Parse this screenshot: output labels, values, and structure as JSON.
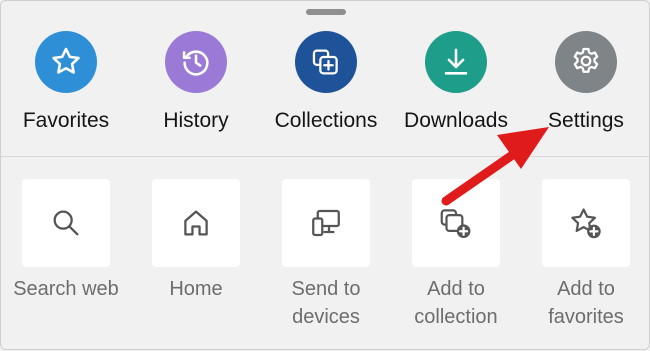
{
  "quick_actions": [
    {
      "label": "Favorites",
      "icon": "star-icon",
      "color": "#2f8fd6"
    },
    {
      "label": "History",
      "icon": "history-clock-icon",
      "color": "#9a7ad6"
    },
    {
      "label": "Collections",
      "icon": "collections-icon",
      "color": "#1f5399"
    },
    {
      "label": "Downloads",
      "icon": "download-icon",
      "color": "#1e9e8a"
    },
    {
      "label": "Settings",
      "icon": "gear-icon",
      "color": "#7e8488"
    }
  ],
  "menu_tiles": [
    {
      "label": "Search web",
      "icon": "search-icon"
    },
    {
      "label": "Home",
      "icon": "home-icon"
    },
    {
      "label": "Send to\ndevices",
      "icon": "send-to-devices-icon"
    },
    {
      "label": "Add to\ncollection",
      "icon": "add-to-collection-icon"
    },
    {
      "label": "Add to\nfavorites",
      "icon": "add-to-favorites-icon"
    }
  ],
  "annotation": {
    "arrow_color": "#e01b1b"
  }
}
